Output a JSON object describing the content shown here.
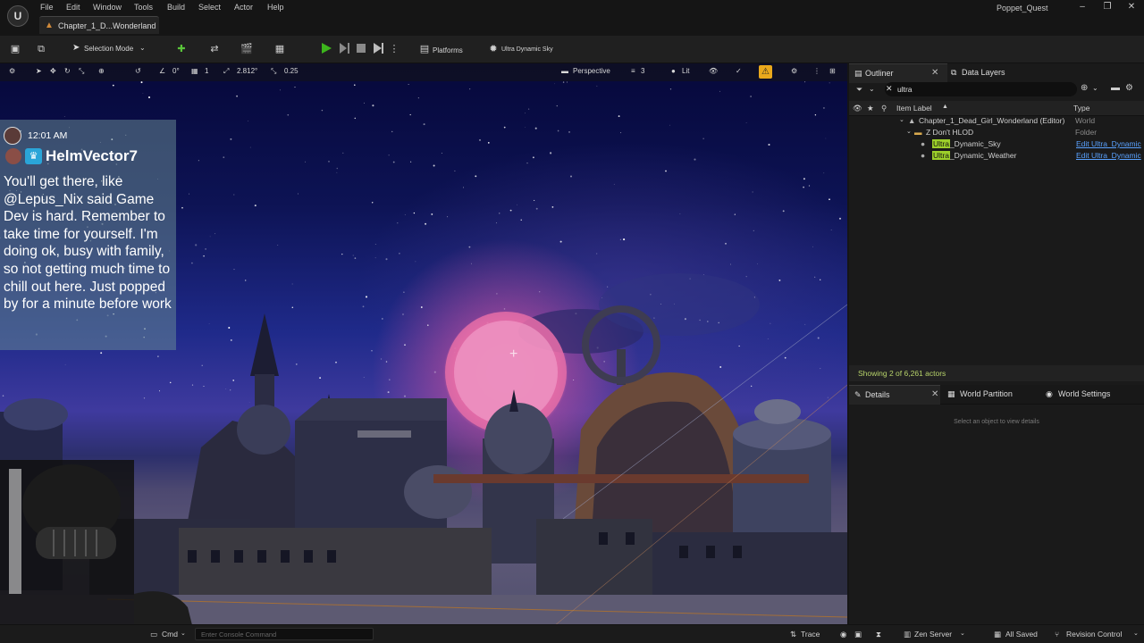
{
  "app": {
    "project_name": "Poppet_Quest",
    "document_tab": "Chapter_1_D...Wonderland",
    "logo_text": "U"
  },
  "menu": [
    "File",
    "Edit",
    "Window",
    "Tools",
    "Build",
    "Select",
    "Actor",
    "Help"
  ],
  "toolbar": {
    "selection_mode": "Selection Mode",
    "platforms": "Platforms",
    "sky_actor": "Ultra Dynamic Sky"
  },
  "viewport_toolbar": {
    "rotation_snap": "0°",
    "grid_snap": "1",
    "camera_speed": "2.812°",
    "scale_snap": "0.25",
    "view_mode": "Perspective",
    "view_count": "3",
    "lighting": "Lit"
  },
  "chat": {
    "time": "12:01 AM",
    "username": "HelmVector7",
    "message": "You'll get there, like @Lepus_Nix said Game Dev is hard. Remember to take time for yourself. I'm doing ok, busy with family, so not getting much time to chill out here. Just popped by for a minute before work"
  },
  "outliner": {
    "tab_label": "Outliner",
    "data_layers_label": "Data Layers",
    "search_value": "ultra",
    "column_item_label": "Item Label",
    "column_type": "Type",
    "rows": [
      {
        "label": "Chapter_1_Dead_Girl_Wonderland (Editor)",
        "type": "World"
      },
      {
        "label": "Z Don't HLOD",
        "type": "Folder"
      },
      {
        "label_highlight": "Ultra",
        "label_rest": "_Dynamic_Sky",
        "type": "Edit Ultra_Dynamic"
      },
      {
        "label_highlight": "Ultra",
        "label_rest": "_Dynamic_Weather",
        "type": "Edit Ultra_Dynamic"
      }
    ],
    "footer": "Showing 2 of 6,261 actors"
  },
  "details": {
    "tab_details": "Details",
    "tab_world_partition": "World Partition",
    "tab_world_settings": "World Settings",
    "empty_message": "Select an object to view details"
  },
  "statusbar": {
    "cmd": "Cmd",
    "console_placeholder": "Enter Console Command",
    "trace": "Trace",
    "zen_server": "Zen Server",
    "all_saved": "All Saved",
    "revision_control": "Revision Control"
  },
  "colors": {
    "accent_play": "#3db51c",
    "lit_badge": "#e9a81c",
    "search_highlight": "#9ccf2a",
    "link": "#5aa2ff"
  }
}
